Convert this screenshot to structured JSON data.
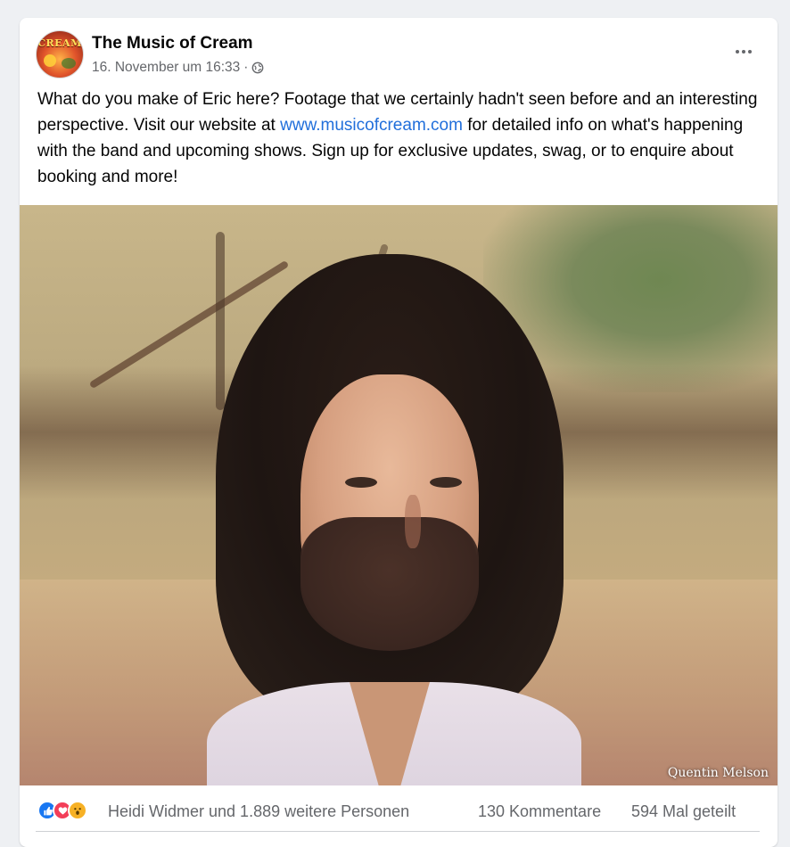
{
  "post": {
    "page_name": "The Music of Cream",
    "avatar_text": "CREAM",
    "timestamp": "16. November um 16:33",
    "separator": "·",
    "audience_icon": "globe-icon",
    "more_icon": "more-horizontal-icon",
    "text_before_link": "What do you make of Eric here? Footage that we certainly hadn't seen before and an interesting perspective. Visit our website at ",
    "link_text": "www.musicofcream.com",
    "text_after_link": " for detailed info on what's happening with the band and upcoming shows. Sign up for exclusive updates, swag, or to enquire about booking and more!",
    "media_watermark": "Quentin Melson"
  },
  "engagement": {
    "reaction_icons": [
      "like-icon",
      "love-icon",
      "wow-icon"
    ],
    "reactors_text": "Heidi Widmer und 1.889 weitere Personen",
    "comments_text": "130 Kommentare",
    "shares_text": "594 Mal geteilt"
  },
  "colors": {
    "link": "#216fdb",
    "secondary_text": "#65676b",
    "like": "#1877f2",
    "love": "#f33e58",
    "wow": "#f7b125"
  }
}
